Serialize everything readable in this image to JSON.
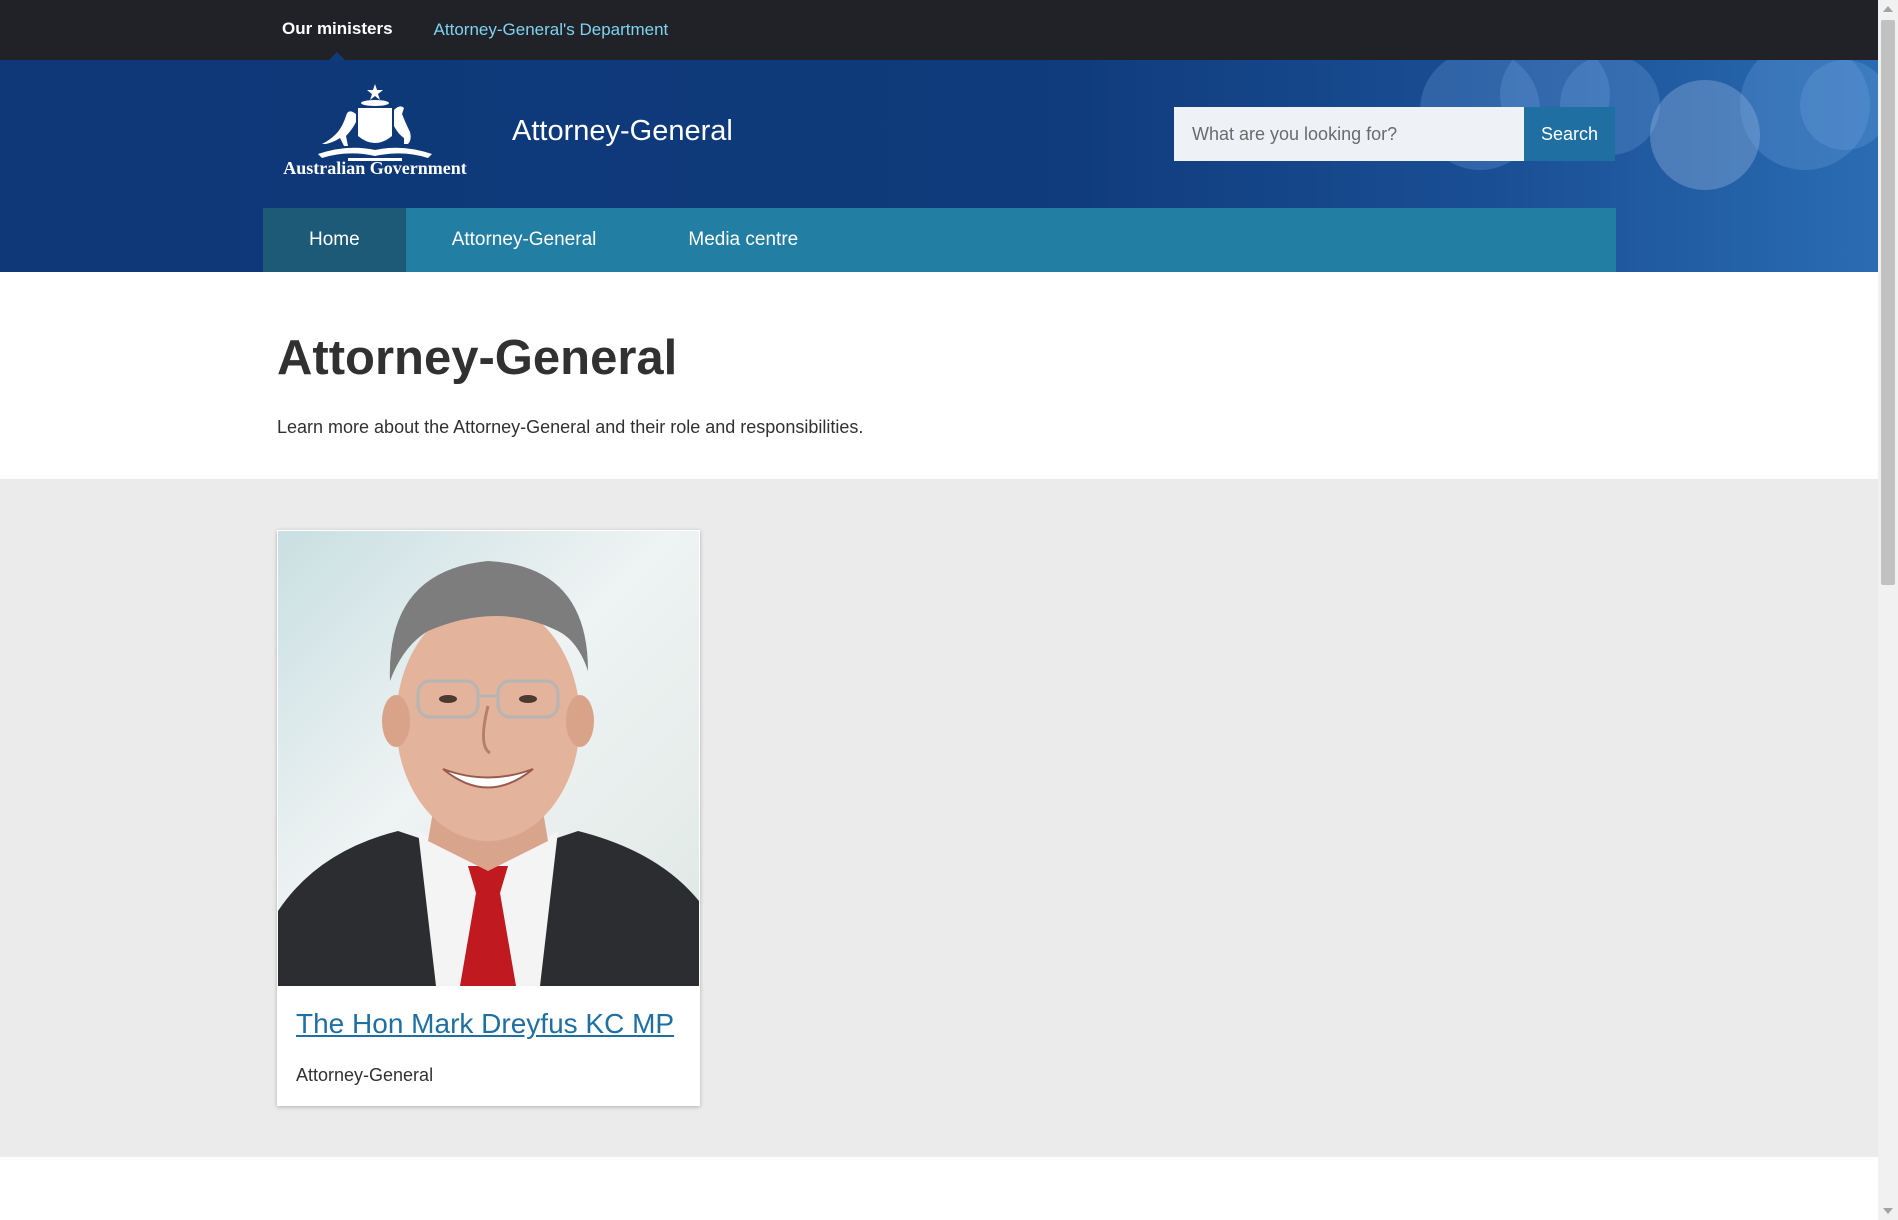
{
  "topbar": {
    "current": "Our ministers",
    "link": "Attorney-General's Department"
  },
  "header": {
    "logo_text": "Australian Government",
    "logo_icon": "coat-of-arms-icon",
    "site_title": "Attorney-General",
    "search": {
      "placeholder": "What are you looking for?",
      "button_label": "Search"
    }
  },
  "nav": {
    "items": [
      {
        "label": "Home",
        "active": true
      },
      {
        "label": "Attorney-General",
        "active": false
      },
      {
        "label": "Media centre",
        "active": false
      }
    ]
  },
  "intro": {
    "title": "Attorney-General",
    "description": "Learn more about the Attorney-General and their role and responsibilities."
  },
  "card": {
    "name": "The Hon Mark Dreyfus KC MP",
    "role": "Attorney-General"
  },
  "colors": {
    "topbar_bg": "#202228",
    "header_bg": "#0f3a7b",
    "nav_bg": "#227ea2",
    "nav_active_bg": "#1c5a77",
    "link_color": "#1f6fa3",
    "band_bg": "#ebebeb"
  }
}
